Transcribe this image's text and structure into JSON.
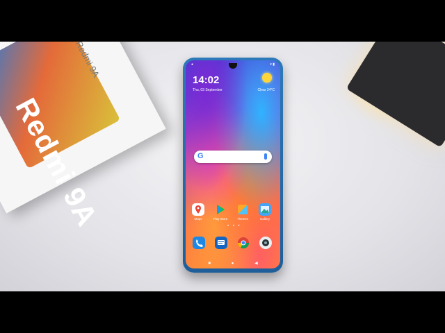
{
  "box": {
    "brand": "Redmi 9A",
    "side_label": "Redmi 9A"
  },
  "phone": {
    "status_left": "●",
    "status_right": "▾ ▮",
    "clock": "14:02",
    "date": "Thu, 03 September",
    "weather": "Clear 24°C",
    "search": {
      "logo": "G"
    },
    "home_apps": [
      {
        "label": "Maps",
        "icon": "maps-icon",
        "color": "#ffffff"
      },
      {
        "label": "Play Store",
        "icon": "play-store-icon",
        "color": "#00c853"
      },
      {
        "label": "Themes",
        "icon": "themes-icon",
        "color": "#ffa726"
      },
      {
        "label": "Gallery",
        "icon": "gallery-icon",
        "color": "#42a5f5"
      }
    ],
    "page_dots": "• • •",
    "dock_apps": [
      {
        "icon": "phone-icon",
        "color": "#1e88e5"
      },
      {
        "icon": "messages-icon",
        "color": "#1565c0"
      },
      {
        "icon": "chrome-icon",
        "color": "#ffffff"
      },
      {
        "icon": "camera-icon",
        "color": "#eceff1"
      }
    ],
    "nav": {
      "menu": "■",
      "home": "●",
      "back": "◀"
    }
  }
}
